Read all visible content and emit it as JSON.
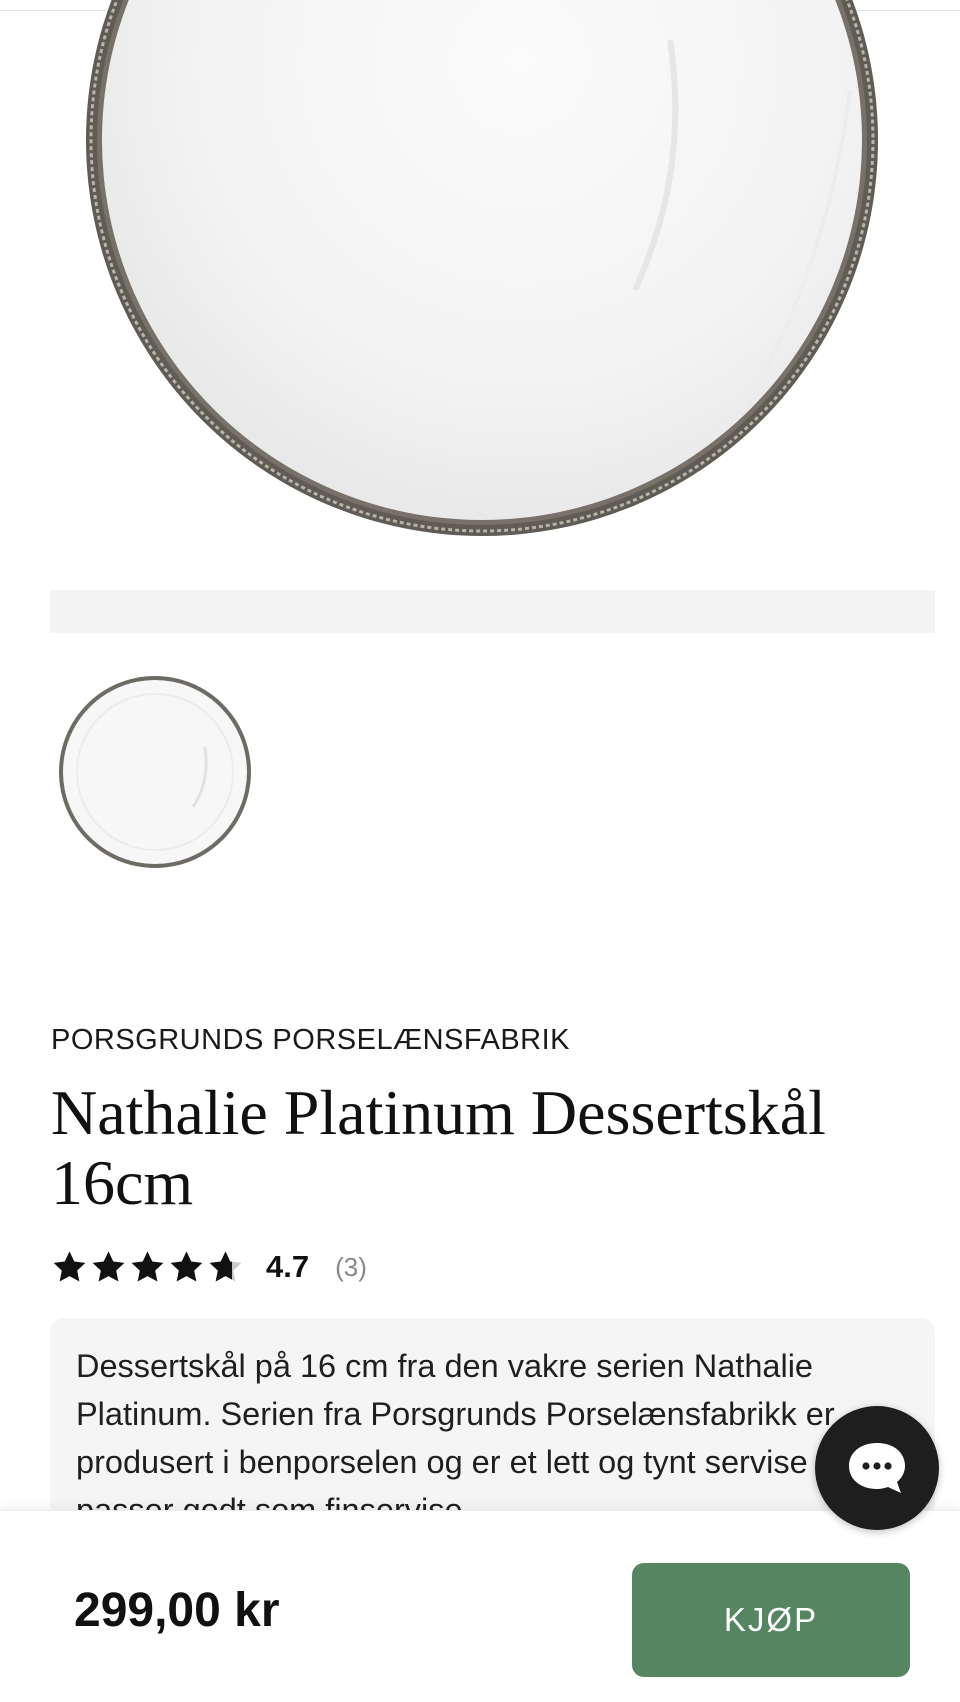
{
  "product": {
    "brand": "PORSGRUNDS PORSELÆNSFABRIK",
    "title": "Nathalie Platinum Dessertskål 16cm",
    "rating": {
      "value_label": "4.7",
      "value": 4.7,
      "max": 5,
      "count_label": "(3)"
    },
    "description": "Dessertskål på 16 cm fra den vakre serien Nathalie Platinum. Serien fra Porsgrunds Porselænsfabrikk er produsert i benporselen og er et lett og tynt servise som passer godt som finservise."
  },
  "purchase": {
    "price": "299,00 kr",
    "buy_label": "KJØP"
  },
  "colors": {
    "buy_button": "#558561",
    "chat_button": "#1e1e1e",
    "rim": "#6e6a64"
  },
  "icons": {
    "chat": "chat-bubble-icon",
    "star": "star-icon"
  }
}
